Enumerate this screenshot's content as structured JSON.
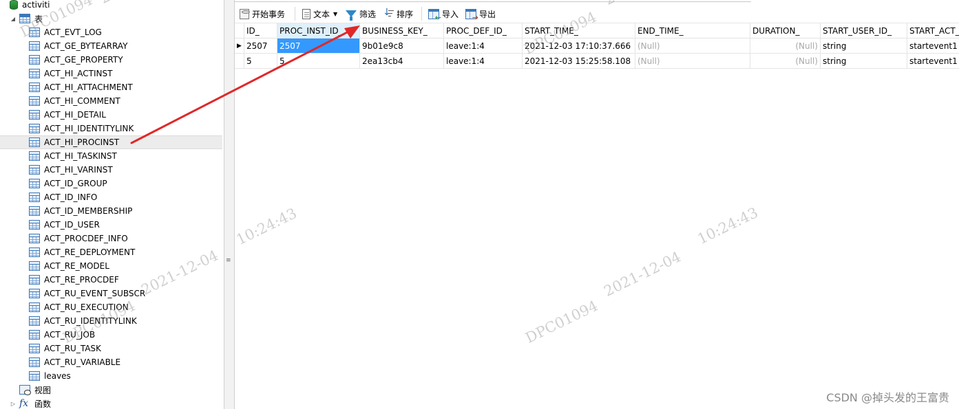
{
  "tree": {
    "db_name": "activiti",
    "tables_group": "表",
    "tables": [
      "ACT_EVT_LOG",
      "ACT_GE_BYTEARRAY",
      "ACT_GE_PROPERTY",
      "ACT_HI_ACTINST",
      "ACT_HI_ATTACHMENT",
      "ACT_HI_COMMENT",
      "ACT_HI_DETAIL",
      "ACT_HI_IDENTITYLINK",
      "ACT_HI_PROCINST",
      "ACT_HI_TASKINST",
      "ACT_HI_VARINST",
      "ACT_ID_GROUP",
      "ACT_ID_INFO",
      "ACT_ID_MEMBERSHIP",
      "ACT_ID_USER",
      "ACT_PROCDEF_INFO",
      "ACT_RE_DEPLOYMENT",
      "ACT_RE_MODEL",
      "ACT_RE_PROCDEF",
      "ACT_RU_EVENT_SUBSCR",
      "ACT_RU_EXECUTION",
      "ACT_RU_IDENTITYLINK",
      "ACT_RU_JOB",
      "ACT_RU_TASK",
      "ACT_RU_VARIABLE",
      "leaves"
    ],
    "selected_table": "ACT_HI_PROCINST",
    "views_group": "视图",
    "functions_group": "函数"
  },
  "toolbar": {
    "begin_transaction": "开始事务",
    "text": "文本",
    "filter": "筛选",
    "sort": "排序",
    "import": "导入",
    "export": "导出"
  },
  "grid": {
    "columns": [
      "ID_",
      "PROC_INST_ID_",
      "BUSINESS_KEY_",
      "PROC_DEF_ID_",
      "START_TIME_",
      "END_TIME_",
      "DURATION_",
      "START_USER_ID_",
      "START_ACT_"
    ],
    "rows": [
      [
        "2507",
        "2507",
        "9b01e9c8",
        "leave:1:4",
        "2021-12-03 17:10:37.666",
        "(Null)",
        "(Null)",
        "string",
        "startevent1"
      ],
      [
        "5",
        "5",
        "2ea13cb4",
        "leave:1:4",
        "2021-12-03 15:25:58.108",
        "(Null)",
        "(Null)",
        "string",
        "startevent1"
      ]
    ]
  },
  "watermark": {
    "id": "DPC01094",
    "date": "2021-12-04",
    "time": "10:24:43"
  },
  "credit": "CSDN @掉头发的王富贵",
  "colors": {
    "selection": "#3399ff",
    "arrow": "#e02828",
    "header_highlight": "#dff0fb"
  }
}
